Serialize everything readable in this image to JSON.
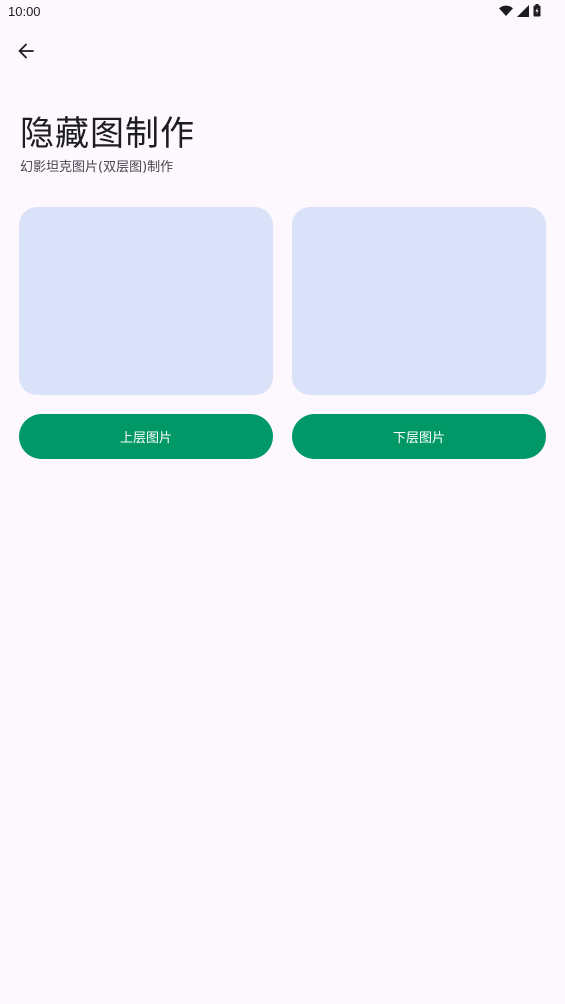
{
  "status_bar": {
    "time": "10:00",
    "icons": [
      "wifi-icon",
      "signal-icon",
      "battery-icon"
    ]
  },
  "header": {
    "back_icon": "arrow-left-icon"
  },
  "main": {
    "title": "隐藏图制作",
    "subtitle": "幻影坦克图片(双层图)制作",
    "upper_button_label": "上层图片",
    "lower_button_label": "下层图片"
  },
  "colors": {
    "background": "#FCF8FE",
    "placeholder": "#DAE2F9",
    "accent": "#009866"
  }
}
